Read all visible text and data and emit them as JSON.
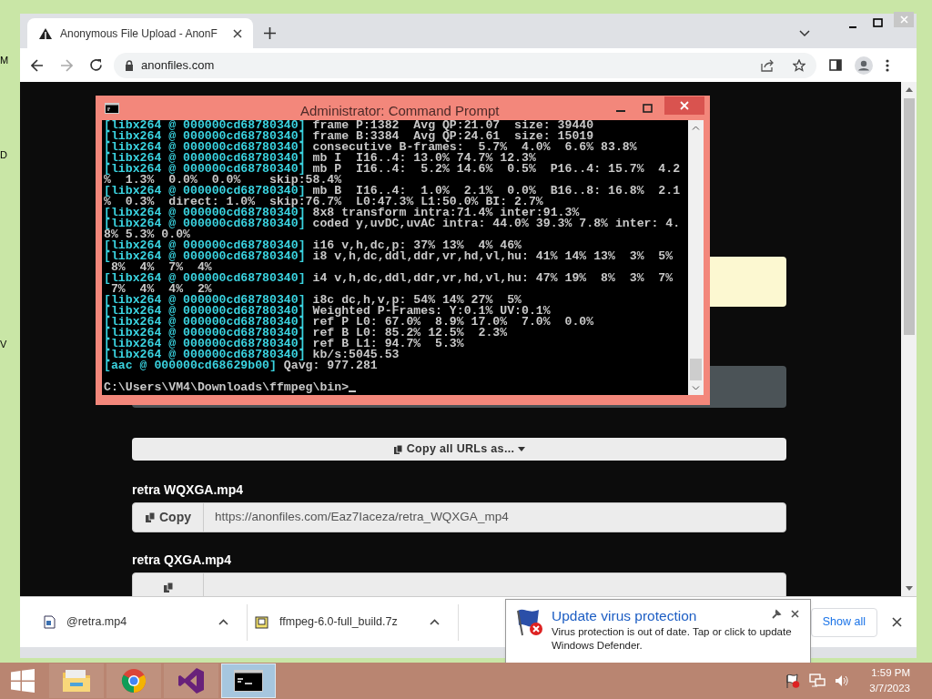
{
  "desktop": {
    "icon_labels": [
      "M",
      "D",
      "V"
    ]
  },
  "browser": {
    "tab": {
      "title": "Anonymous File Upload - AnonF",
      "selected": true
    },
    "address": "anonfiles.com"
  },
  "page": {
    "copy_all_button": "Copy all URLs as...",
    "files": [
      {
        "name": "retra WQXGA.mp4",
        "copy_label": "Copy",
        "url": "https://anonfiles.com/Eaz7Iaceza/retra_WQXGA_mp4"
      },
      {
        "name": "retra QXGA.mp4"
      }
    ]
  },
  "console": {
    "title": "Administrator:  Command Prompt",
    "lines": [
      {
        "prefix": "[libx264 @ 000000cd68780340]",
        "text": " frame P:1382  Avg QP:21.07  size: 39440"
      },
      {
        "prefix": "[libx264 @ 000000cd68780340]",
        "text": " frame B:3384  Avg QP:24.61  size: 15019"
      },
      {
        "prefix": "[libx264 @ 000000cd68780340]",
        "text": " consecutive B-frames:  5.7%  4.0%  6.6% 83.8%"
      },
      {
        "prefix": "[libx264 @ 000000cd68780340]",
        "text": " mb I  I16..4: 13.0% 74.7% 12.3%"
      },
      {
        "prefix": "[libx264 @ 000000cd68780340]",
        "text": " mb P  I16..4:  5.2% 14.6%  0.5%  P16..4: 15.7%  4.2"
      },
      {
        "text": "%  1.3%  0.0%  0.0%    skip:58.4%"
      },
      {
        "prefix": "[libx264 @ 000000cd68780340]",
        "text": " mb B  I16..4:  1.0%  2.1%  0.0%  B16..8: 16.8%  2.1"
      },
      {
        "text": "%  0.3%  direct: 1.0%  skip:76.7%  L0:47.3% L1:50.0% BI: 2.7%"
      },
      {
        "prefix": "[libx264 @ 000000cd68780340]",
        "text": " 8x8 transform intra:71.4% inter:91.3%"
      },
      {
        "prefix": "[libx264 @ 000000cd68780340]",
        "text": " coded y,uvDC,uvAC intra: 44.0% 39.3% 7.8% inter: 4."
      },
      {
        "text": "8% 5.3% 0.0%"
      },
      {
        "prefix": "[libx264 @ 000000cd68780340]",
        "text": " i16 v,h,dc,p: 37% 13%  4% 46%"
      },
      {
        "prefix": "[libx264 @ 000000cd68780340]",
        "text": " i8 v,h,dc,ddl,ddr,vr,hd,vl,hu: 41% 14% 13%  3%  5%"
      },
      {
        "text": " 8%  4%  7%  4%"
      },
      {
        "prefix": "[libx264 @ 000000cd68780340]",
        "text": " i4 v,h,dc,ddl,ddr,vr,hd,vl,hu: 47% 19%  8%  3%  7%"
      },
      {
        "text": " 7%  4%  4%  2%"
      },
      {
        "prefix": "[libx264 @ 000000cd68780340]",
        "text": " i8c dc,h,v,p: 54% 14% 27%  5%"
      },
      {
        "prefix": "[libx264 @ 000000cd68780340]",
        "text": " Weighted P-Frames: Y:0.1% UV:0.1%"
      },
      {
        "prefix": "[libx264 @ 000000cd68780340]",
        "text": " ref P L0: 67.0%  8.9% 17.0%  7.0%  0.0%"
      },
      {
        "prefix": "[libx264 @ 000000cd68780340]",
        "text": " ref B L0: 85.2% 12.5%  2.3%"
      },
      {
        "prefix": "[libx264 @ 000000cd68780340]",
        "text": " ref B L1: 94.7%  5.3%"
      },
      {
        "prefix": "[libx264 @ 000000cd68780340]",
        "text": " kb/s:5045.53"
      },
      {
        "prefix": "[aac @ 000000cd68629b00]",
        "text": " Qavg: 977.281"
      }
    ],
    "prompt": "C:\\Users\\VM4\\Downloads\\ffmpeg\\bin>"
  },
  "downloads": {
    "items": [
      {
        "name": "@retra.mp4",
        "kind": "video"
      },
      {
        "name": "ffmpeg-6.0-full_build.7z",
        "kind": "archive"
      }
    ],
    "show_all": "Show all"
  },
  "notification": {
    "title": "Update virus protection",
    "message": "Virus protection is out of date. Tap or click to update Windows Defender."
  },
  "taskbar": {
    "apps": [
      {
        "kind": "explorer",
        "selected": false
      },
      {
        "kind": "chrome",
        "selected": false
      },
      {
        "kind": "studio",
        "selected": false
      },
      {
        "kind": "console",
        "selected": true
      }
    ],
    "time": "1:59 PM",
    "date": "3/7/2023"
  }
}
